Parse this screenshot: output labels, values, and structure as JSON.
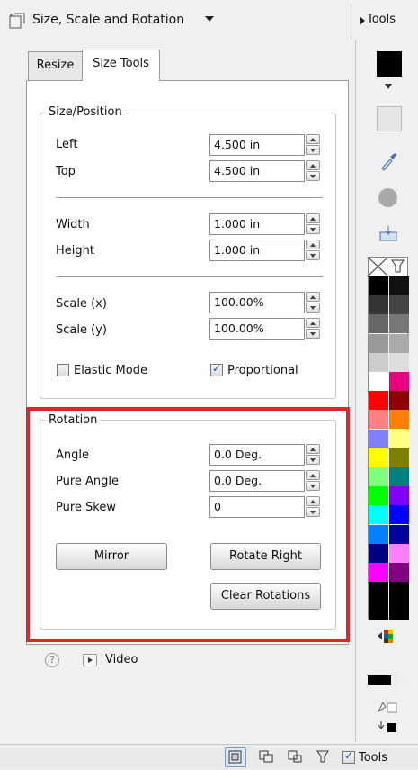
{
  "header": {
    "title": "Size, Scale and Rotation",
    "tools_label": "Tools"
  },
  "tabs": [
    {
      "label": "Resize",
      "active": false
    },
    {
      "label": "Size Tools",
      "active": true
    }
  ],
  "size_position": {
    "legend": "Size/Position",
    "left": {
      "label": "Left",
      "value": "4.500 in"
    },
    "top": {
      "label": "Top",
      "value": "4.500 in"
    },
    "width": {
      "label": "Width",
      "value": "1.000 in"
    },
    "height": {
      "label": "Height",
      "value": "1.000 in"
    },
    "scale_x": {
      "label": "Scale (x)",
      "value": "100.00%"
    },
    "scale_y": {
      "label": "Scale (y)",
      "value": "100.00%"
    },
    "elastic_mode": {
      "label": "Elastic Mode",
      "checked": false
    },
    "proportional": {
      "label": "Proportional",
      "checked": true
    }
  },
  "rotation": {
    "legend": "Rotation",
    "angle": {
      "label": "Angle",
      "value": "0.0 Deg."
    },
    "pure_angle": {
      "label": "Pure Angle",
      "value": "0.0 Deg."
    },
    "pure_skew": {
      "label": "Pure Skew",
      "value": "0"
    },
    "mirror_label": "Mirror",
    "rotate_right_label": "Rotate Right",
    "clear_rotations_label": "Clear Rotations"
  },
  "help": {
    "icon": "help-icon",
    "video_label": "Video"
  },
  "colors": {
    "highlight": "#e0262b",
    "foreground": "#000000",
    "background": "#e6e6e6",
    "palette": [
      [
        "#000000",
        "#111111"
      ],
      [
        "#333333",
        "#444444"
      ],
      [
        "#666666",
        "#777777"
      ],
      [
        "#999999",
        "#aaaaaa"
      ],
      [
        "#cccccc",
        "#dddddd"
      ],
      [
        "#ffffff",
        "#e8007c"
      ],
      [
        "#ff0000",
        "#8b0000"
      ],
      [
        "#ff8080",
        "#ff8000"
      ],
      [
        "#8080ff",
        "#ffff80"
      ],
      [
        "#ffff00",
        "#808000"
      ],
      [
        "#80ff80",
        "#008080"
      ],
      [
        "#00ff00",
        "#8000ff"
      ],
      [
        "#00ffff",
        "#0000ff"
      ],
      [
        "#0080ff",
        "#0000a0"
      ],
      [
        "#000080",
        "#ff80ff"
      ],
      [
        "#ff00ff",
        "#800080"
      ],
      [
        "#000000",
        "#000000"
      ],
      [
        "#000000",
        "#000000"
      ]
    ]
  },
  "bottombar": {
    "tools_label": "Tools",
    "tools_checked": true
  }
}
